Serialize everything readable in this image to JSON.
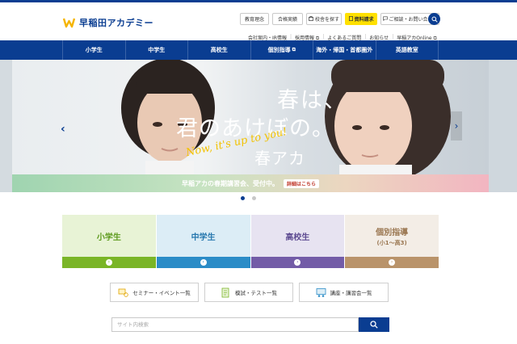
{
  "header": {
    "logo_text": "早稲田アカデミー",
    "utility_buttons": [
      {
        "label": "教育理念"
      },
      {
        "label": "合格実績"
      },
      {
        "label": "校舎を探す"
      },
      {
        "label": "資料請求"
      },
      {
        "label": "ご相談・お問い合わせ"
      }
    ],
    "sub_links": [
      {
        "label": "会社案内・IR情報"
      },
      {
        "label": "採用情報"
      },
      {
        "label": "よくあるご質問"
      },
      {
        "label": "お知らせ"
      },
      {
        "label": "早稲アカOnline"
      }
    ]
  },
  "nav": {
    "items": [
      {
        "label": "小学生"
      },
      {
        "label": "中学生"
      },
      {
        "label": "高校生"
      },
      {
        "label": "個別指導"
      },
      {
        "label": "海外・帰国・首都圏外"
      },
      {
        "label": "英語教室"
      }
    ]
  },
  "hero": {
    "line1": "春は、",
    "line2": "君のあけぼの。",
    "line3": "春アカ",
    "script": "Now, it's up to you!",
    "banner_text": "早稲アカの春期講習会、受付中。",
    "banner_link": "詳細はこちら"
  },
  "grades": [
    {
      "title": "小学生",
      "sub": "",
      "top_color": "#e8f3d6",
      "bottom_color": "#7ab527",
      "text_color": "#5c9a1c"
    },
    {
      "title": "中学生",
      "sub": "",
      "top_color": "#dcedf6",
      "bottom_color": "#2b8cc7",
      "text_color": "#2778ae"
    },
    {
      "title": "高校生",
      "sub": "",
      "top_color": "#e7e3f1",
      "bottom_color": "#735ca7",
      "text_color": "#5d4a91"
    },
    {
      "title": "個別指導",
      "sub": "(小1〜高3)",
      "top_color": "#f3ede6",
      "bottom_color": "#b9936a",
      "text_color": "#9a7650"
    }
  ],
  "quick_links": [
    {
      "label": "セミナー・イベント一覧"
    },
    {
      "label": "模試・テスト一覧"
    },
    {
      "label": "講座・講習会一覧"
    }
  ],
  "site_search": {
    "placeholder": "サイト内検索"
  },
  "colors": {
    "brand": "#0a3d91",
    "accent_yellow": "#ffe000"
  }
}
